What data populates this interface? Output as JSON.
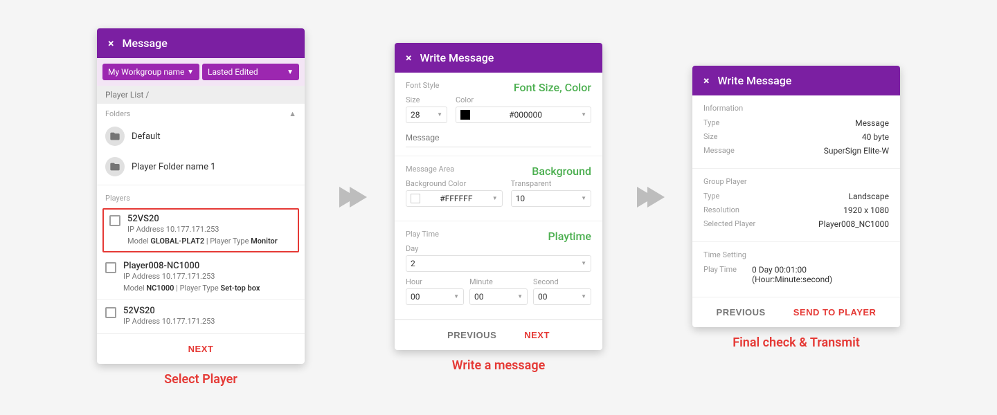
{
  "panels": [
    {
      "id": "select-player",
      "header": {
        "title": "Message",
        "close": "×"
      },
      "workgroup": {
        "name": "My Workgroup name",
        "sort": "Lasted Edited"
      },
      "breadcrumb": "Player List /",
      "folders_section": {
        "label": "Folders",
        "items": [
          {
            "name": "Default"
          },
          {
            "name": "Player Folder name 1"
          }
        ]
      },
      "players_section": {
        "label": "Players",
        "items": [
          {
            "name": "52VS20",
            "ip": "IP Address 10.177.171.253",
            "model": "GLOBAL-PLAT2",
            "player_type": "Monitor",
            "selected": true
          },
          {
            "name": "Player008-NC1000",
            "ip": "IP Address 10.177.171.253",
            "model": "NC1000",
            "player_type": "Set-top box",
            "selected": false
          },
          {
            "name": "52VS20",
            "ip": "IP Address 10.177.171.253",
            "model": "",
            "player_type": "",
            "selected": false
          }
        ]
      },
      "footer": {
        "next_label": "NEXT"
      }
    },
    {
      "id": "write-message",
      "header": {
        "title": "Write Message",
        "close": "×"
      },
      "font_style_section": {
        "label": "Font Style",
        "highlight": "Font Size, Color",
        "size_label": "Size",
        "size_value": "28",
        "color_label": "Color",
        "color_value": "#000000",
        "message_placeholder": "Message"
      },
      "message_area_section": {
        "label": "Message Area",
        "highlight": "Background",
        "bg_color_label": "Background Color",
        "bg_color_value": "#FFFFFF",
        "transparent_label": "Transparent",
        "transparent_value": "10"
      },
      "play_time_section": {
        "label": "Play Time",
        "highlight": "Playtime",
        "day_label": "Day",
        "day_value": "2",
        "hour_label": "Hour",
        "hour_value": "00",
        "minute_label": "Minute",
        "minute_value": "00",
        "second_label": "Second",
        "second_value": "00"
      },
      "footer": {
        "previous_label": "PREVIOUS",
        "next_label": "NEXT"
      }
    },
    {
      "id": "final-check",
      "header": {
        "title": "Write Message",
        "close": "×"
      },
      "information_section": {
        "label": "Information",
        "type_label": "Type",
        "type_value": "Message",
        "size_label": "Size",
        "size_value": "40 byte",
        "message_label": "Message",
        "message_value": "SuperSign Elite-W"
      },
      "group_player_section": {
        "label": "Group Player",
        "type_label": "Type",
        "type_value": "Landscape",
        "resolution_label": "Resolution",
        "resolution_value": "1920 x 1080",
        "selected_player_label": "Selected Player",
        "selected_player_value": "Player008_NC1000"
      },
      "time_setting_section": {
        "label": "Time Setting",
        "play_time_label": "Play Time",
        "play_time_value": "0 Day 00:01:00 (Hour:Minute:second)"
      },
      "footer": {
        "previous_label": "PREVIOUS",
        "send_label": "SEND TO PLAYER"
      }
    }
  ],
  "step_labels": [
    "Select Player",
    "Write a message",
    "Final check & Transmit"
  ],
  "arrow": "❯"
}
